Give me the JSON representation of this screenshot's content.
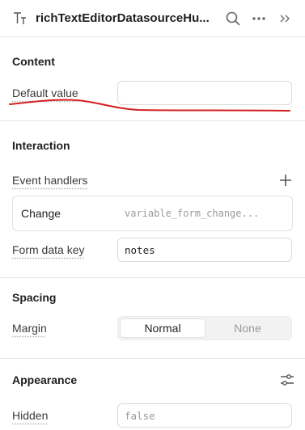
{
  "header": {
    "title": "richTextEditorDatasourceHu...",
    "type_icon": "text-type-icon",
    "actions": [
      "search-icon",
      "more-icon",
      "collapse-icon"
    ]
  },
  "content": {
    "title": "Content",
    "default_value_label": "Default value",
    "default_value": ""
  },
  "interaction": {
    "title": "Interaction",
    "event_handlers_label": "Event handlers",
    "handler": {
      "event": "Change",
      "action": "variable_form_change..."
    },
    "form_data_key_label": "Form data key",
    "form_data_key_value": "notes"
  },
  "spacing": {
    "title": "Spacing",
    "margin_label": "Margin",
    "options": [
      "Normal",
      "None"
    ],
    "selected": "Normal"
  },
  "appearance": {
    "title": "Appearance",
    "hidden_label": "Hidden",
    "hidden_placeholder": "false"
  },
  "colors": {
    "annotation": "#d42020",
    "border": "#e6e6e6",
    "text": "#1f1f1f"
  }
}
